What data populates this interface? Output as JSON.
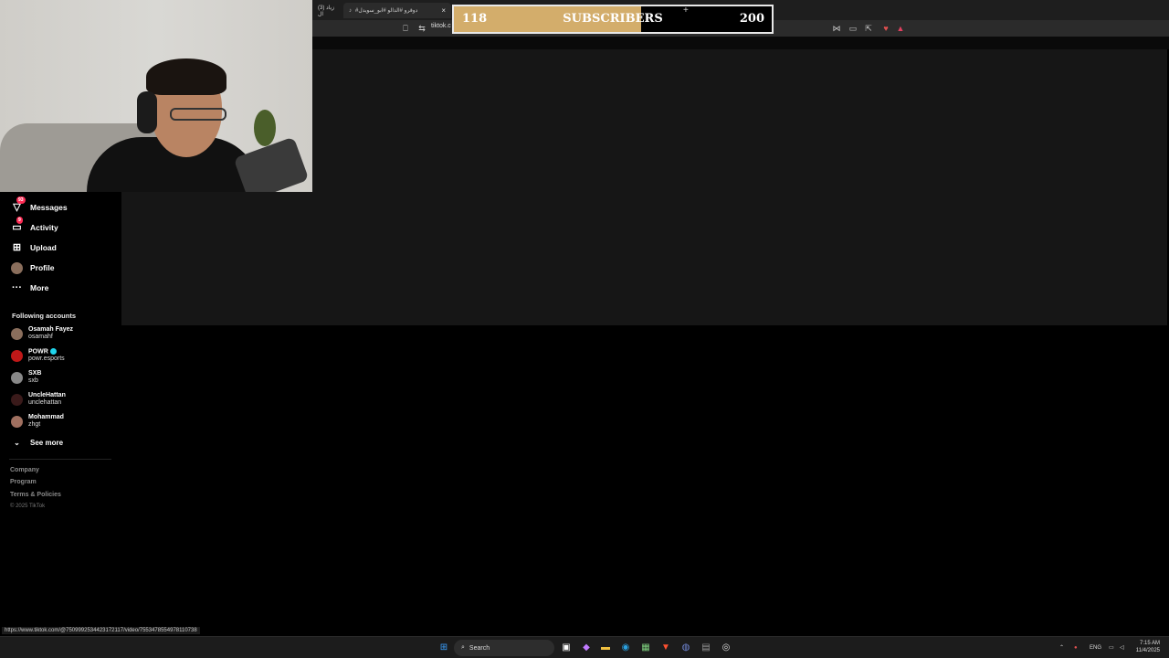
{
  "browser": {
    "tabs": [
      {
        "title": "(3) زياد ال"
      },
      {
        "title": "#دوقرو #الدالو #ابو_سويدل",
        "close": "×"
      }
    ],
    "newtab_plus": "+",
    "url": "tiktok.c"
  },
  "overlay": {
    "subscribers": {
      "current": "118",
      "label": "SUBSCRIBERS",
      "goal": "200",
      "progress": 0.59,
      "fill_color": "#d3ad6b"
    }
  },
  "sidebar": {
    "nav": [
      {
        "label": "Messages",
        "icon": "messages-icon",
        "badge": "93"
      },
      {
        "label": "Activity",
        "icon": "activity-icon",
        "badge": "9"
      },
      {
        "label": "Upload",
        "icon": "upload-icon"
      },
      {
        "label": "Profile",
        "icon": "profile-avatar"
      },
      {
        "label": "More",
        "icon": "more-icon"
      }
    ],
    "following_title": "Following accounts",
    "accounts": [
      {
        "name": "Osamah Fayez",
        "username": "osamahf",
        "color": "#8a6e5c"
      },
      {
        "name": "POWR",
        "username": "powr.esports",
        "verified": true,
        "color": "#c01818"
      },
      {
        "name": "SXB",
        "username": "sxb",
        "color": "#888888"
      },
      {
        "name": "UncleHattan",
        "username": "unclehattan",
        "color": "#3a1a1a"
      },
      {
        "name": "Mohammad",
        "username": "zhgt",
        "color": "#a07060"
      }
    ],
    "see_more": "See more",
    "footer": [
      "Company",
      "Program",
      "Terms & Policies"
    ],
    "copyright": "© 2025 TikTok"
  },
  "status_url": "https://www.tiktok.com/@7509992534423172117/video/7553478554978110738",
  "taskbar": {
    "search_placeholder": "Search",
    "language": "ENG",
    "time": "7:15 AM",
    "date": "11/4/2025"
  }
}
